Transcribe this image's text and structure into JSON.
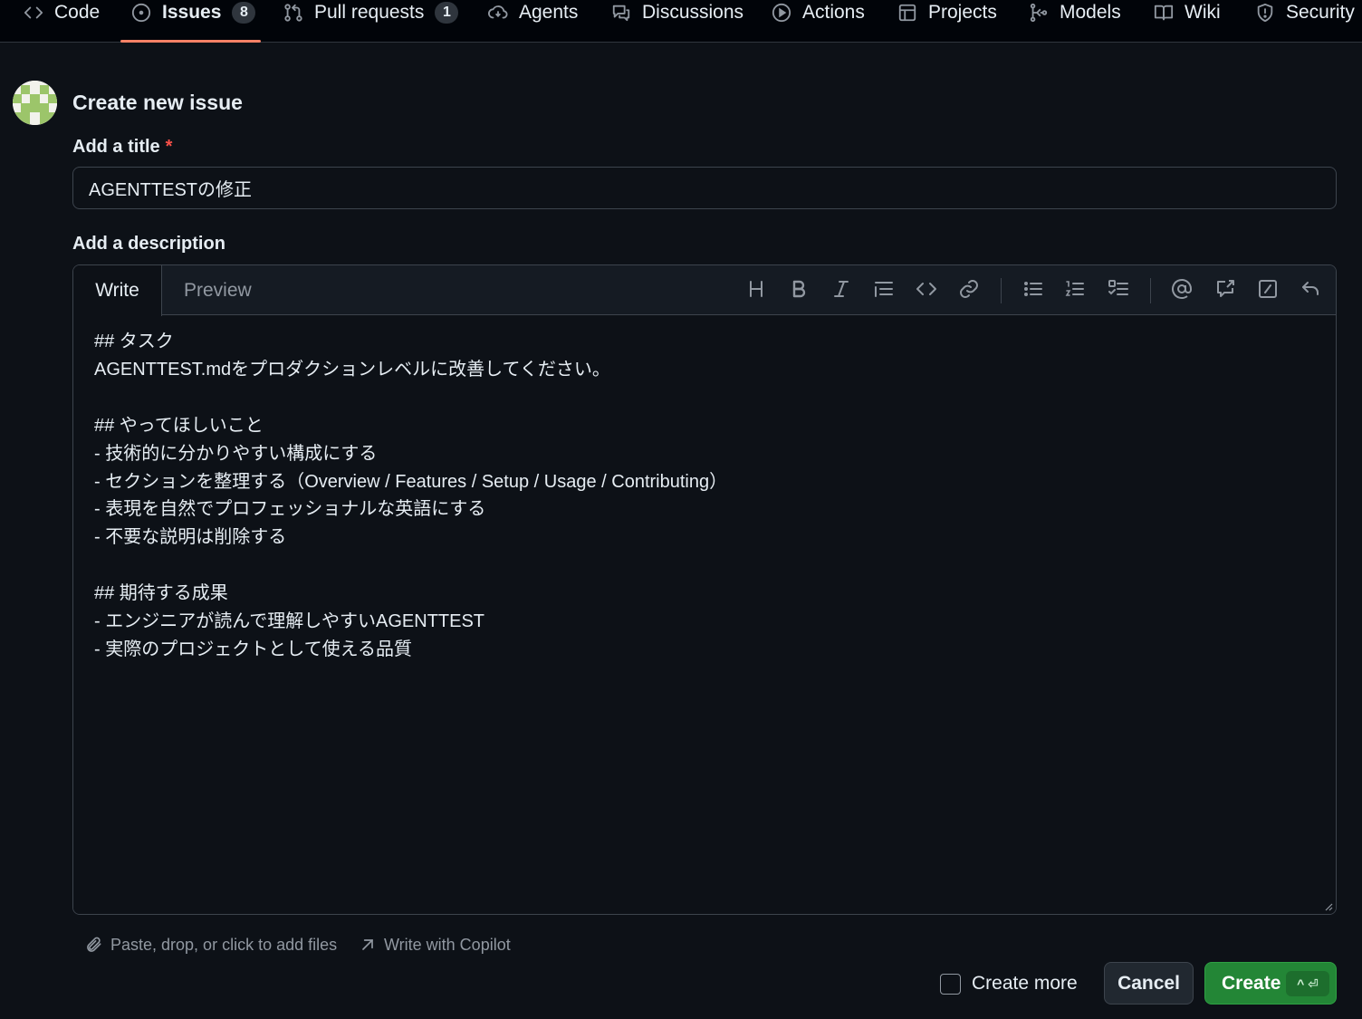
{
  "nav": {
    "items": [
      {
        "label": "Code",
        "icon": "code-icon"
      },
      {
        "label": "Issues",
        "icon": "issue-opened-icon",
        "counter": "8",
        "active": true
      },
      {
        "label": "Pull requests",
        "icon": "git-pull-request-icon",
        "counter": "1"
      },
      {
        "label": "Agents",
        "icon": "agent-icon"
      },
      {
        "label": "Discussions",
        "icon": "comment-discussion-icon"
      },
      {
        "label": "Actions",
        "icon": "play-icon"
      },
      {
        "label": "Projects",
        "icon": "table-icon"
      },
      {
        "label": "Models",
        "icon": "ai-model-icon"
      },
      {
        "label": "Wiki",
        "icon": "book-icon"
      },
      {
        "label": "Security",
        "icon": "shield-icon"
      }
    ],
    "active_color": "#f78166"
  },
  "page": {
    "title": "Create new issue",
    "title_label": "Add a title",
    "required_marker": "*",
    "description_label": "Add a description"
  },
  "issue": {
    "title_value": "AGENTTESTの修正",
    "body": "## タスク\nAGENTTEST.mdをプロダクションレベルに改善してください。\n\n## やってほしいこと\n- 技術的に分かりやすい構成にする\n- セクションを整理する（Overview / Features / Setup / Usage / Contributing）\n- 表現を自然でプロフェッショナルな英語にする\n- 不要な説明は削除する\n\n## 期待する成果\n- エンジニアが読んで理解しやすいAGENTTEST\n- 実際のプロジェクトとして使える品質"
  },
  "editor": {
    "tabs": [
      "Write",
      "Preview"
    ],
    "active_tab": "Write",
    "toolbar_icons": [
      "heading-icon",
      "bold-icon",
      "italic-icon",
      "quote-icon",
      "code-icon",
      "link-icon",
      "unordered-list-icon",
      "ordered-list-icon",
      "task-list-icon",
      "mention-icon",
      "cross-reference-icon",
      "slash-command-icon",
      "undo-icon"
    ]
  },
  "footer": {
    "attach_label": "Paste, drop, or click to add files",
    "copilot_label": "Write with Copilot",
    "create_more_label": "Create more",
    "create_more_checked": false,
    "cancel_label": "Cancel",
    "create_label": "Create",
    "create_shortcut": "^ ⏎"
  },
  "colors": {
    "background": "#0d1117",
    "nav_background": "#010409",
    "primary_button": "#238636",
    "required": "#f85149",
    "border": "#3d444d"
  }
}
